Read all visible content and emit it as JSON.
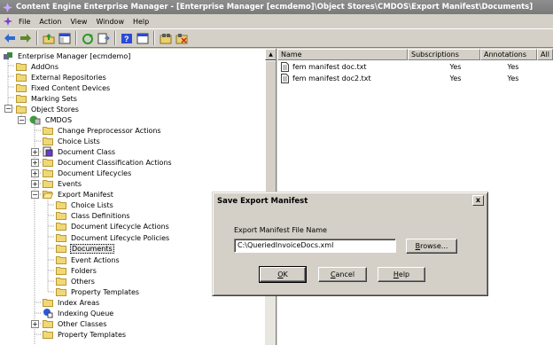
{
  "window": {
    "title": "Content Engine Enterprise Manager - [Enterprise Manager [ecmdemo]\\Object Stores\\CMDOS\\Export Manifest\\Documents]"
  },
  "menu": {
    "items": [
      "File",
      "Action",
      "View",
      "Window",
      "Help"
    ]
  },
  "tree": {
    "root": "Enterprise Manager [ecmdemo]",
    "items": [
      "AddOns",
      "External Repositories",
      "Fixed Content Devices",
      "Marking Sets",
      "Object Stores",
      "CMDOS",
      "Change Preprocessor Actions",
      "Choice Lists",
      "Document Class",
      "Document Classification Actions",
      "Document Lifecycles",
      "Events",
      "Export Manifest",
      "Choice Lists",
      "Class Definitions",
      "Document Lifecycle Actions",
      "Document Lifecycle Policies",
      "Documents",
      "Event Actions",
      "Folders",
      "Others",
      "Property Templates",
      "Index Areas",
      "Indexing Queue",
      "Other Classes",
      "Property Templates"
    ]
  },
  "list": {
    "columns": [
      "Name",
      "Subscriptions",
      "Annotations",
      "All Do"
    ],
    "rows": [
      {
        "name": "fem manifest doc.txt",
        "subscriptions": "Yes",
        "annotations": "Yes"
      },
      {
        "name": "fem manifest doc2.txt",
        "subscriptions": "Yes",
        "annotations": "Yes"
      }
    ]
  },
  "dialog": {
    "title": "Save Export Manifest",
    "close": "x",
    "field_label": "Export Manifest File Name",
    "field_value": "C:\\QueriedInvoiceDocs.xml",
    "browse": {
      "u": "B",
      "rest": "rowse..."
    },
    "ok": {
      "u": "O",
      "rest": "K"
    },
    "cancel": {
      "u": "C",
      "rest": "ancel"
    },
    "help": {
      "u": "H",
      "rest": "elp"
    }
  }
}
